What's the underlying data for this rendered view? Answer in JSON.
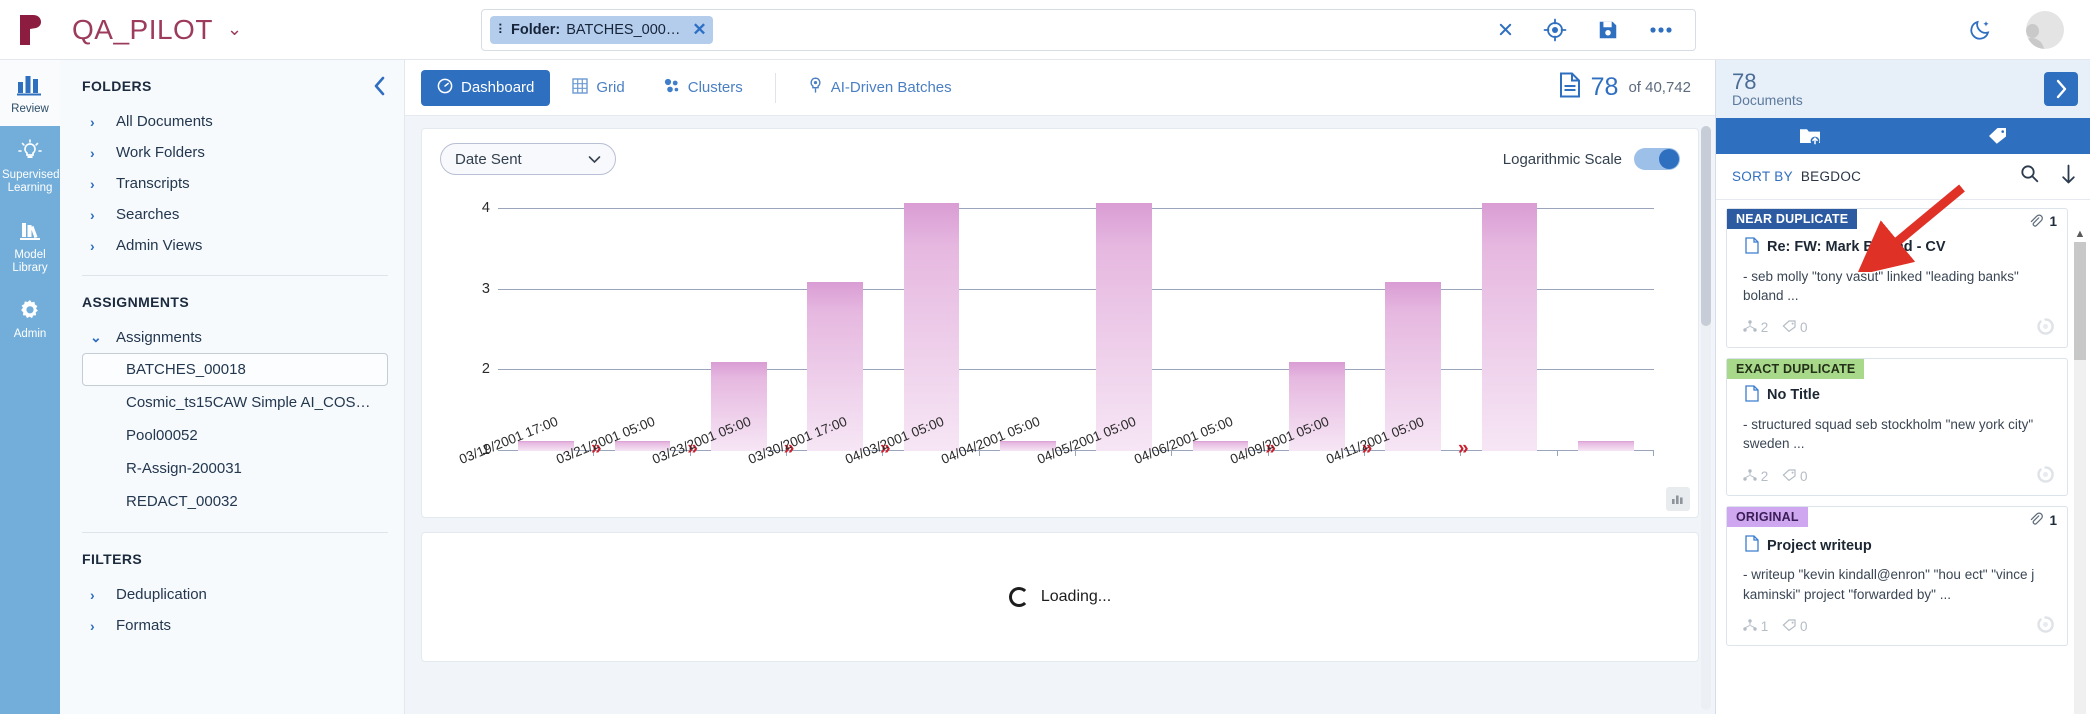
{
  "app": {
    "logo": "r-logo-icon",
    "title": "QA_PILOT",
    "caret": "⌄"
  },
  "search": {
    "chip_grip": "⠇",
    "chip_prefix": "Folder:",
    "chip_value": "BATCHES_000…",
    "chip_close": "✕",
    "tools": [
      {
        "name": "clear-search-icon",
        "glyph": "✕"
      },
      {
        "name": "target-locate-icon",
        "glyph": "◎"
      },
      {
        "name": "save-search-icon",
        "glyph": "ὋE"
      },
      {
        "name": "more-options-icon",
        "glyph": "•••"
      }
    ],
    "dark_mode": "dark-mode-icon"
  },
  "rail": {
    "items": [
      {
        "label": "Review",
        "icon": "bar-chart-icon",
        "active": true
      },
      {
        "label": "Supervised Learning",
        "icon": "lightbulb-icon",
        "active": false
      },
      {
        "label": "Model Library",
        "icon": "books-icon",
        "active": false
      },
      {
        "label": "Admin",
        "icon": "gear-icon",
        "active": false
      }
    ]
  },
  "folders": {
    "heading": "FOLDERS",
    "collapse": "‹",
    "items": [
      {
        "label": "All Documents"
      },
      {
        "label": "Work Folders"
      },
      {
        "label": "Transcripts"
      },
      {
        "label": "Searches"
      },
      {
        "label": "Admin Views"
      }
    ],
    "assignments_heading": "ASSIGNMENTS",
    "assignments_group": "Assignments",
    "assignments": [
      {
        "label": "BATCHES_00018",
        "selected": true
      },
      {
        "label": "Cosmic_ts15CAW Simple AI_COS…",
        "selected": false
      },
      {
        "label": "Pool00052",
        "selected": false
      },
      {
        "label": "R-Assign-200031",
        "selected": false
      },
      {
        "label": "REDACT_00032",
        "selected": false
      }
    ],
    "filters_heading": "FILTERS",
    "filters": [
      {
        "label": "Deduplication"
      },
      {
        "label": "Formats"
      }
    ]
  },
  "tabs": [
    {
      "label": "Dashboard",
      "icon": "dashboard-gauge-icon",
      "active": true
    },
    {
      "label": "Grid",
      "icon": "grid-icon",
      "active": false
    },
    {
      "label": "Clusters",
      "icon": "clusters-icon",
      "active": false
    },
    {
      "label": "AI-Driven Batches",
      "icon": "lightbulb-pin-icon",
      "active": false
    }
  ],
  "doccount": {
    "icon": "document-icon",
    "current": "78",
    "total": "of 40,742"
  },
  "chart_controls": {
    "field_select": "Date Sent",
    "field_caret": "⌄",
    "log_label": "Logarithmic Scale",
    "log_on": true,
    "chart_toggle_icon": "bar-chart-icon"
  },
  "chart_data": {
    "type": "bar",
    "title": "",
    "xlabel": "",
    "ylabel": "",
    "log_scale": true,
    "grid": true,
    "yticks": [
      1,
      2,
      3,
      4
    ],
    "ylim": [
      1,
      4.2
    ],
    "categories": [
      "03/19/2001 17:00",
      "03/21/2001 05:00",
      "03/23/2001 05:00",
      "03/30/2001 17:00",
      "04/03/2001 05:00",
      "04/04/2001 05:00",
      "04/05/2001 05:00",
      "04/06/2001 05:00",
      "04/09/2001 05:00",
      "04/11/2001 05:00"
    ],
    "values": [
      1.13,
      1.13,
      2.1,
      3.1,
      4.07,
      1.13,
      4.07,
      1.13,
      2.1,
      3.1
    ],
    "extra_values": [
      4.07,
      1.13
    ],
    "gap_markers": [
      1,
      2,
      3,
      4,
      8,
      9,
      10
    ],
    "series": [
      {
        "name": "Documents",
        "values": [
          1.13,
          1.13,
          2.1,
          3.1,
          4.07,
          1.13,
          4.07,
          1.13,
          2.1,
          3.1,
          4.07,
          1.13
        ]
      }
    ]
  },
  "loading": {
    "label": "Loading...",
    "icon": "spinner-icon"
  },
  "right_panel": {
    "count": "78",
    "count_label": "Documents",
    "next_icon": "chevron-right-icon",
    "tools": [
      {
        "name": "folder-upload-icon"
      },
      {
        "name": "tag-icon"
      }
    ],
    "sort_by_label": "SORT BY",
    "sort_by_value": "BEGDOC",
    "sort_tools": [
      {
        "name": "search-icon"
      },
      {
        "name": "sort-descending-icon"
      }
    ],
    "documents": [
      {
        "badge": "NEAR DUPLICATE",
        "badge_type": "near",
        "attachments": "1",
        "title": "Re: FW: Mark Boland - CV",
        "snippet": "- seb molly \"tony vasut\" linked \"leading banks\" boland ...",
        "cluster_count": "2",
        "tag_count": "0"
      },
      {
        "badge": "EXACT DUPLICATE",
        "badge_type": "exact",
        "attachments": "",
        "title": "No Title",
        "snippet": "- structured squad seb stockholm \"new york city\" sweden ...",
        "cluster_count": "2",
        "tag_count": "0"
      },
      {
        "badge": "ORIGINAL",
        "badge_type": "original",
        "attachments": "1",
        "title": "Project writeup",
        "snippet": "- writeup \"kevin kindall@enron\" \"hou ect\" \"vince j kaminski\" project \"forwarded by\" ...",
        "cluster_count": "1",
        "tag_count": "0"
      }
    ]
  },
  "colors": {
    "brand": "#9d3b5c",
    "accent": "#2f6fc0",
    "rail": "#72aed9",
    "bar": "#d99dd4",
    "annotation": "#e03127"
  }
}
